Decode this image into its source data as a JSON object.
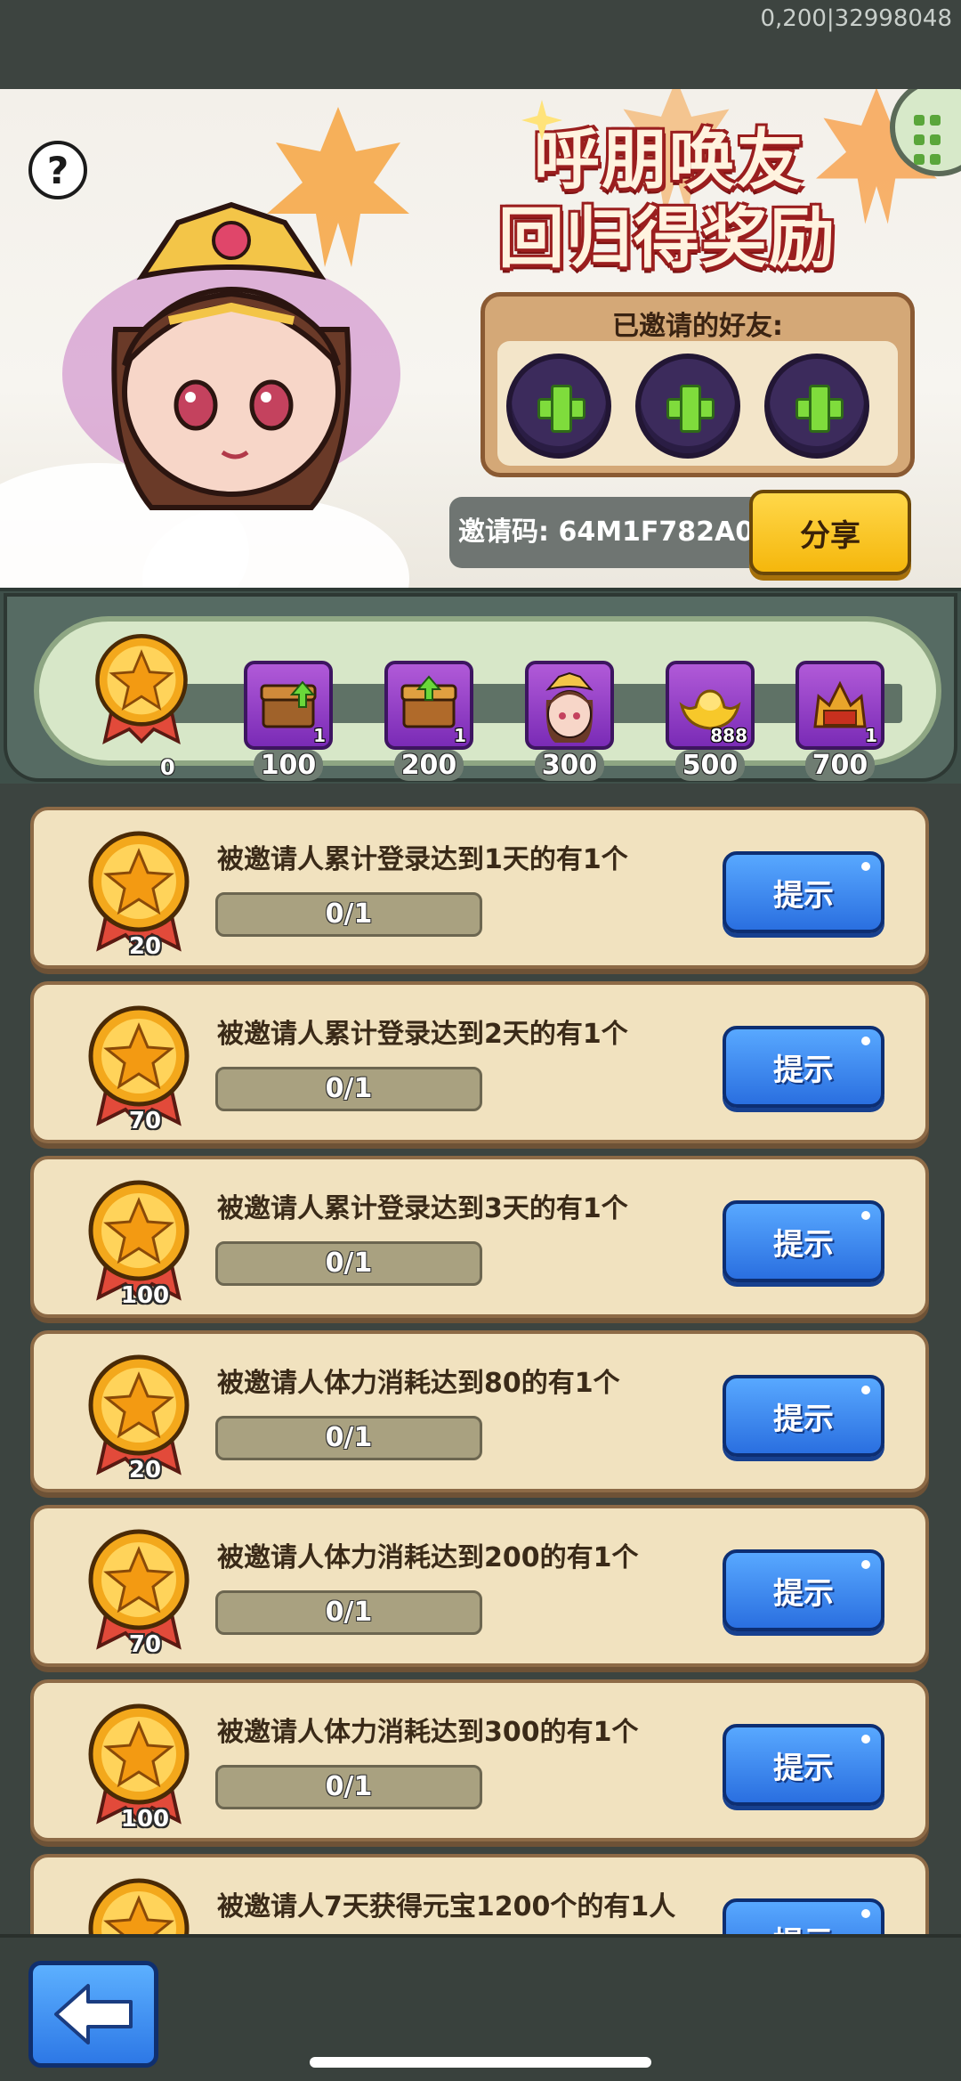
{
  "debug": "0,200|32998048",
  "banner": {
    "title_line1": "呼朋唤友",
    "title_line2": "回归得奖励",
    "invited_label": "已邀请的好友:",
    "invite_code": "邀请码: 64M1F782A0",
    "share_label": "分享",
    "help_symbol": "?"
  },
  "progress": {
    "current": "0",
    "tiers": [
      {
        "points": "100",
        "count": "1",
        "icon": "chest-up-icon"
      },
      {
        "points": "200",
        "count": "1",
        "icon": "chest-up-icon"
      },
      {
        "points": "300",
        "count": "",
        "icon": "hero-portrait-icon"
      },
      {
        "points": "500",
        "count": "888",
        "icon": "gold-ingot-icon"
      },
      {
        "points": "700",
        "count": "1",
        "icon": "helmet-icon"
      }
    ]
  },
  "tasks": [
    {
      "title": "被邀请人累计登录达到1天的有1个",
      "progress": "0/1",
      "reward": "20",
      "button": "提示"
    },
    {
      "title": "被邀请人累计登录达到2天的有1个",
      "progress": "0/1",
      "reward": "70",
      "button": "提示"
    },
    {
      "title": "被邀请人累计登录达到3天的有1个",
      "progress": "0/1",
      "reward": "100",
      "button": "提示"
    },
    {
      "title": "被邀请人体力消耗达到80的有1个",
      "progress": "0/1",
      "reward": "20",
      "button": "提示"
    },
    {
      "title": "被邀请人体力消耗达到200的有1个",
      "progress": "0/1",
      "reward": "70",
      "button": "提示"
    },
    {
      "title": "被邀请人体力消耗达到300的有1个",
      "progress": "0/1",
      "reward": "100",
      "button": "提示"
    },
    {
      "title": "被邀请人7天获得元宝1200个的有1人",
      "progress": "",
      "reward": "",
      "button": "提示"
    }
  ],
  "colors": {
    "accent_blue": "#2a6fe0",
    "accent_yellow": "#f5b70c",
    "panel_beige": "#f1e2bf"
  }
}
